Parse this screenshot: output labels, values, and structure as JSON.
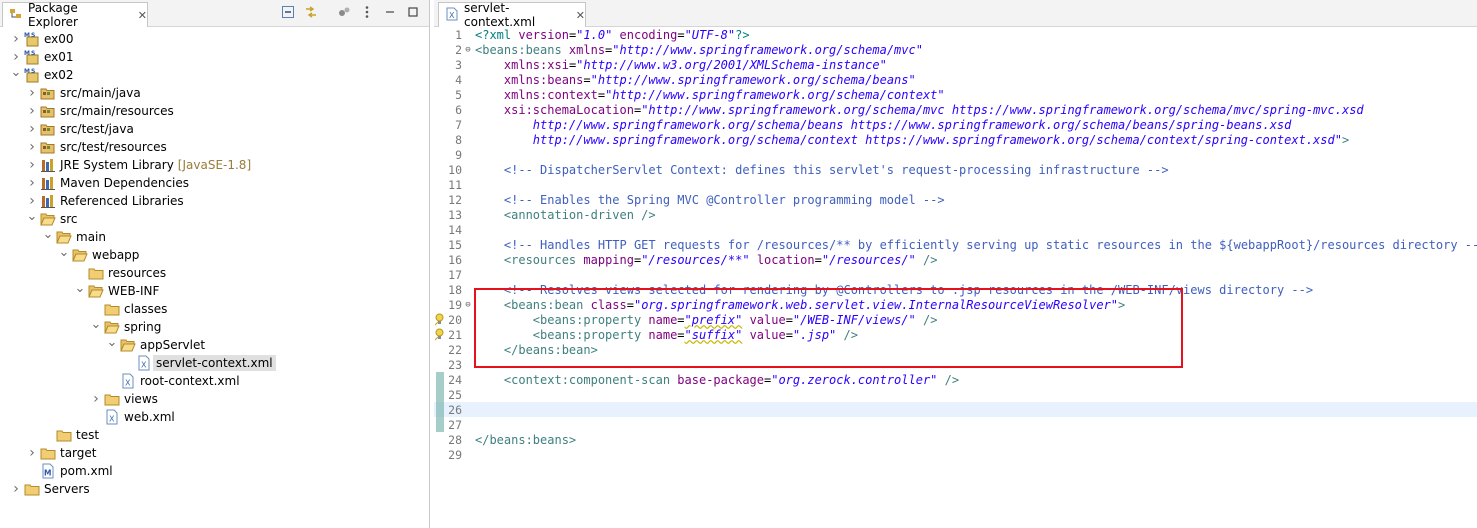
{
  "package_explorer": {
    "tab_title": "Package Explorer",
    "tree": [
      {
        "label": "ex00",
        "suffix": "",
        "level": 0,
        "expand": "closed",
        "icon": "maven-project-icon"
      },
      {
        "label": "ex01",
        "suffix": "",
        "level": 0,
        "expand": "closed",
        "icon": "maven-project-icon"
      },
      {
        "label": "ex02",
        "suffix": "",
        "level": 0,
        "expand": "open",
        "icon": "maven-project-icon"
      },
      {
        "label": "src/main/java",
        "suffix": "",
        "level": 1,
        "expand": "closed",
        "icon": "source-folder-icon"
      },
      {
        "label": "src/main/resources",
        "suffix": "",
        "level": 1,
        "expand": "closed",
        "icon": "source-folder-icon"
      },
      {
        "label": "src/test/java",
        "suffix": "",
        "level": 1,
        "expand": "closed",
        "icon": "source-folder-icon"
      },
      {
        "label": "src/test/resources",
        "suffix": "",
        "level": 1,
        "expand": "closed",
        "icon": "source-folder-icon"
      },
      {
        "label": "JRE System Library",
        "suffix": "[JavaSE-1.8]",
        "level": 1,
        "expand": "closed",
        "icon": "library-icon"
      },
      {
        "label": "Maven Dependencies",
        "suffix": "",
        "level": 1,
        "expand": "closed",
        "icon": "library-icon"
      },
      {
        "label": "Referenced Libraries",
        "suffix": "",
        "level": 1,
        "expand": "closed",
        "icon": "library-icon"
      },
      {
        "label": "src",
        "suffix": "",
        "level": 1,
        "expand": "open",
        "icon": "folder-open-icon"
      },
      {
        "label": "main",
        "suffix": "",
        "level": 2,
        "expand": "open",
        "icon": "folder-open-icon"
      },
      {
        "label": "webapp",
        "suffix": "",
        "level": 3,
        "expand": "open",
        "icon": "folder-open-icon"
      },
      {
        "label": "resources",
        "suffix": "",
        "level": 4,
        "expand": "none",
        "icon": "folder-icon"
      },
      {
        "label": "WEB-INF",
        "suffix": "",
        "level": 4,
        "expand": "open",
        "icon": "folder-open-icon"
      },
      {
        "label": "classes",
        "suffix": "",
        "level": 5,
        "expand": "none",
        "icon": "folder-icon"
      },
      {
        "label": "spring",
        "suffix": "",
        "level": 5,
        "expand": "open",
        "icon": "folder-open-icon"
      },
      {
        "label": "appServlet",
        "suffix": "",
        "level": 6,
        "expand": "open",
        "icon": "folder-open-icon"
      },
      {
        "label": "servlet-context.xml",
        "suffix": "",
        "level": 7,
        "expand": "none",
        "icon": "xml-file-icon",
        "selected": true
      },
      {
        "label": "root-context.xml",
        "suffix": "",
        "level": 6,
        "expand": "none",
        "icon": "xml-file-icon"
      },
      {
        "label": "views",
        "suffix": "",
        "level": 5,
        "expand": "closed",
        "icon": "folder-icon"
      },
      {
        "label": "web.xml",
        "suffix": "",
        "level": 5,
        "expand": "none",
        "icon": "xml-file-icon"
      },
      {
        "label": "test",
        "suffix": "",
        "level": 2,
        "expand": "none",
        "icon": "folder-icon"
      },
      {
        "label": "target",
        "suffix": "",
        "level": 1,
        "expand": "closed",
        "icon": "folder-icon"
      },
      {
        "label": "pom.xml",
        "suffix": "",
        "level": 1,
        "expand": "none",
        "icon": "pom-file-icon"
      },
      {
        "label": "Servers",
        "suffix": "",
        "level": 0,
        "expand": "closed",
        "icon": "folder-icon"
      }
    ]
  },
  "editor": {
    "tab_title": "servlet-context.xml",
    "lines": [
      [
        [
          "pi",
          "<?xml "
        ],
        [
          "attr",
          "version"
        ],
        [
          "txt",
          "="
        ],
        [
          "val",
          "\"1.0\""
        ],
        [
          "txt",
          " "
        ],
        [
          "attr",
          "encoding"
        ],
        [
          "txt",
          "="
        ],
        [
          "val",
          "\"UTF-8\""
        ],
        [
          "pi",
          "?>"
        ]
      ],
      [
        [
          "tag",
          "<beans:beans "
        ],
        [
          "attr",
          "xmlns"
        ],
        [
          "txt",
          "="
        ],
        [
          "val",
          "\"http://www.springframework.org/schema/mvc\""
        ]
      ],
      [
        [
          "txt",
          "    "
        ],
        [
          "attr",
          "xmlns:xsi"
        ],
        [
          "txt",
          "="
        ],
        [
          "val",
          "\"http://www.w3.org/2001/XMLSchema-instance\""
        ]
      ],
      [
        [
          "txt",
          "    "
        ],
        [
          "attr",
          "xmlns:beans"
        ],
        [
          "txt",
          "="
        ],
        [
          "val",
          "\"http://www.springframework.org/schema/beans\""
        ]
      ],
      [
        [
          "txt",
          "    "
        ],
        [
          "attr",
          "xmlns:context"
        ],
        [
          "txt",
          "="
        ],
        [
          "val",
          "\"http://www.springframework.org/schema/context\""
        ]
      ],
      [
        [
          "txt",
          "    "
        ],
        [
          "attr",
          "xsi:schemaLocation"
        ],
        [
          "txt",
          "="
        ],
        [
          "val",
          "\"http://www.springframework.org/schema/mvc https://www.springframework.org/schema/mvc/spring-mvc.xsd"
        ]
      ],
      [
        [
          "txt",
          "        "
        ],
        [
          "val",
          "http://www.springframework.org/schema/beans https://www.springframework.org/schema/beans/spring-beans.xsd"
        ]
      ],
      [
        [
          "txt",
          "        "
        ],
        [
          "val",
          "http://www.springframework.org/schema/context https://www.springframework.org/schema/context/spring-context.xsd\""
        ],
        [
          "tag",
          ">"
        ]
      ],
      [],
      [
        [
          "txt",
          "    "
        ],
        [
          "com",
          "<!-- DispatcherServlet Context: defines this servlet's request-processing infrastructure -->"
        ]
      ],
      [],
      [
        [
          "txt",
          "    "
        ],
        [
          "com",
          "<!-- Enables the Spring MVC @Controller programming model -->"
        ]
      ],
      [
        [
          "txt",
          "    "
        ],
        [
          "tag",
          "<annotation-driven />"
        ]
      ],
      [],
      [
        [
          "txt",
          "    "
        ],
        [
          "com",
          "<!-- Handles HTTP GET requests for /resources/** by efficiently serving up static resources in the ${webappRoot}/resources directory -->"
        ]
      ],
      [
        [
          "txt",
          "    "
        ],
        [
          "tag",
          "<resources "
        ],
        [
          "attr",
          "mapping"
        ],
        [
          "txt",
          "="
        ],
        [
          "val",
          "\"/resources/**\""
        ],
        [
          "txt",
          " "
        ],
        [
          "attr",
          "location"
        ],
        [
          "txt",
          "="
        ],
        [
          "val",
          "\"/resources/\""
        ],
        [
          "tag",
          " />"
        ]
      ],
      [],
      [
        [
          "txt",
          "    "
        ],
        [
          "com",
          "<!-- Resolves views selected for rendering by @Controllers to .jsp resources in the /WEB-INF/views directory -->"
        ]
      ],
      [
        [
          "txt",
          "    "
        ],
        [
          "tag",
          "<beans:bean "
        ],
        [
          "attr",
          "class"
        ],
        [
          "txt",
          "="
        ],
        [
          "val",
          "\"org.springframework.web.servlet.view.InternalResourceViewResolver\""
        ],
        [
          "tag",
          ">"
        ]
      ],
      [
        [
          "txt",
          "        "
        ],
        [
          "tag",
          "<beans:property "
        ],
        [
          "attr",
          "name"
        ],
        [
          "txt",
          "="
        ],
        [
          "valsq",
          "\"prefix\""
        ],
        [
          "txt",
          " "
        ],
        [
          "attr",
          "value"
        ],
        [
          "txt",
          "="
        ],
        [
          "val",
          "\"/WEB-INF/views/\""
        ],
        [
          "tag",
          " />"
        ]
      ],
      [
        [
          "txt",
          "        "
        ],
        [
          "tag",
          "<beans:property "
        ],
        [
          "attr",
          "name"
        ],
        [
          "txt",
          "="
        ],
        [
          "valsq",
          "\"suffix\""
        ],
        [
          "txt",
          " "
        ],
        [
          "attr",
          "value"
        ],
        [
          "txt",
          "="
        ],
        [
          "val",
          "\".jsp\""
        ],
        [
          "tag",
          " />"
        ]
      ],
      [
        [
          "txt",
          "    "
        ],
        [
          "tag",
          "</beans:bean>"
        ]
      ],
      [],
      [
        [
          "txt",
          "    "
        ],
        [
          "tag",
          "<context:component-scan "
        ],
        [
          "attr",
          "base-package"
        ],
        [
          "txt",
          "="
        ],
        [
          "val",
          "\"org.zerock.controller\""
        ],
        [
          "tag",
          " />"
        ]
      ],
      [],
      [],
      [],
      [
        [
          "tag",
          "</beans:beans>"
        ]
      ],
      []
    ],
    "fold_lines": [
      2,
      19
    ],
    "warning_lines": [
      20,
      21
    ],
    "current_line": 26
  },
  "colors": {
    "highlight_box": "#e5121b",
    "current_line_bg": "#e8f2fe"
  }
}
